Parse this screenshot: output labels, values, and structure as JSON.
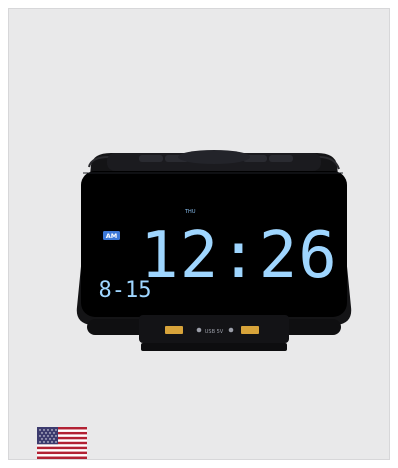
{
  "product": {
    "display": {
      "meridiem": "AM",
      "day": "THU",
      "time": "12:26",
      "date": "8-15"
    },
    "port_label": "USB 5V",
    "colors": {
      "background": "#e9e9ea",
      "body": "#121214",
      "screen": "#000000",
      "digits": "#9fd6ff",
      "port": "#d7a33a"
    }
  },
  "flag": {
    "name": "us-flag-icon"
  }
}
